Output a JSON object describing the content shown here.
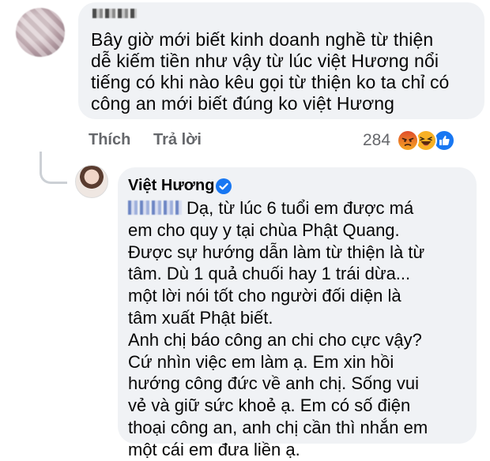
{
  "comment": {
    "text": "Bây giờ mới biết kinh doanh nghề từ thiện\ndễ kiếm tiền như vậy từ lúc việt Hương nổi\ntiếng có khi nào kêu gọi từ thiện ko ta chỉ có\ncông an mới biết đúng ko việt Hương",
    "actions": {
      "like": "Thích",
      "reply": "Trả lời"
    },
    "reaction_count": "284",
    "reactions": [
      "angry-icon",
      "haha-icon",
      "like-icon"
    ],
    "colors": {
      "bubble": "#f0f2f5",
      "muted": "#65676b",
      "like_blue": "#1877f2",
      "emoji_yellow": "#f7b125",
      "angry_red": "#e9710f"
    }
  },
  "reply": {
    "author": "Việt Hương",
    "verified_icon": "verified-badge-icon",
    "text": "Dạ, từ lúc 6 tuổi em được má\nem cho quy y tại chùa Phật Quang.\nĐược sự hướng dẫn làm từ thiện là từ\ntâm. Dù 1 quả chuối hay 1 trái dừa...\nmột lời nói tốt cho người đối diện là\ntâm xuất Phật biết.\nAnh chị báo công an chi cho cực vậy?\nCứ nhìn việc em làm ạ. Em xin hồi\nhướng công đức về anh chị. Sống vui\nvẻ và giữ sức khoẻ ạ. Em có số điện\nthoại công an, anh chị cần thì nhắn em\nmột cái em đưa liền ạ."
  }
}
